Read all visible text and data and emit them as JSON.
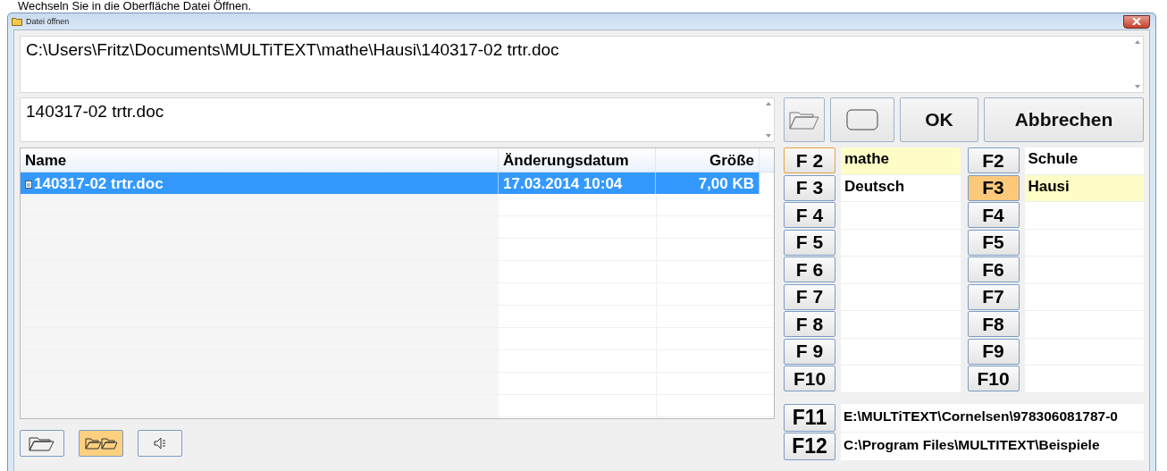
{
  "caption": "Wechseln Sie in die Oberfläche Datei Öffnen.",
  "window": {
    "title": "Datei öffnen"
  },
  "path_field": {
    "value": "C:\\Users\\Fritz\\Documents\\MULTiTEXT\\mathe\\Hausi\\140317-02 trtr.doc"
  },
  "filename_field": {
    "value": "140317-02 trtr.doc"
  },
  "toolbar": [
    {
      "kind": "folder"
    },
    {
      "kind": "blank"
    },
    {
      "kind": "text",
      "label": "OK"
    },
    {
      "kind": "text",
      "label": "Abbrechen"
    }
  ],
  "file_list": {
    "columns": [
      "Name",
      "Änderungsdatum",
      "Größe"
    ],
    "rows": [
      {
        "name": "140317-02 trtr.doc",
        "modified": "17.03.2014 10:04",
        "size": "7,00 KB",
        "selected": true
      }
    ]
  },
  "folder_keys_left": [
    {
      "key": "F 2",
      "folder": "mathe",
      "selected": true,
      "focused": true,
      "active": false
    },
    {
      "key": "F 3",
      "folder": "Deutsch",
      "selected": false,
      "focused": false,
      "active": false
    },
    {
      "key": "F 4",
      "selected": false,
      "focused": false,
      "active": false
    },
    {
      "key": "F 5",
      "selected": false,
      "focused": false,
      "active": false
    },
    {
      "key": "F 6",
      "selected": false,
      "focused": false,
      "active": false
    },
    {
      "key": "F 7",
      "selected": false,
      "focused": false,
      "active": false
    },
    {
      "key": "F 8",
      "selected": false,
      "focused": false,
      "active": false
    },
    {
      "key": "F 9",
      "selected": false,
      "focused": false,
      "active": false
    },
    {
      "key": "F10",
      "selected": false,
      "focused": false,
      "active": false
    }
  ],
  "folder_keys_right": [
    {
      "key": "F2",
      "folder": "Schule",
      "selected": false,
      "focused": false,
      "active": false
    },
    {
      "key": "F3",
      "folder": "Hausi",
      "selected": true,
      "focused": false,
      "active": true
    },
    {
      "key": "F4",
      "selected": false,
      "focused": false,
      "active": false
    },
    {
      "key": "F5",
      "selected": false,
      "focused": false,
      "active": false
    },
    {
      "key": "F6",
      "selected": false,
      "focused": false,
      "active": false
    },
    {
      "key": "F7",
      "selected": false,
      "focused": false,
      "active": false
    },
    {
      "key": "F8",
      "selected": false,
      "focused": false,
      "active": false
    },
    {
      "key": "F9",
      "selected": false,
      "focused": false,
      "active": false
    },
    {
      "key": "F10",
      "selected": false,
      "focused": false,
      "active": false
    }
  ],
  "path_keys": [
    {
      "key": "F11",
      "path": "E:\\MULTiTEXT\\Cornelsen\\978306081787-0"
    },
    {
      "key": "F12",
      "path": "C:\\Program Files\\MULTITEXT\\Beispiele"
    }
  ],
  "bottom_buttons": [
    {
      "kind": "folder",
      "selected": false
    },
    {
      "kind": "two-folders",
      "selected": true
    },
    {
      "kind": "speaker",
      "selected": false
    }
  ]
}
